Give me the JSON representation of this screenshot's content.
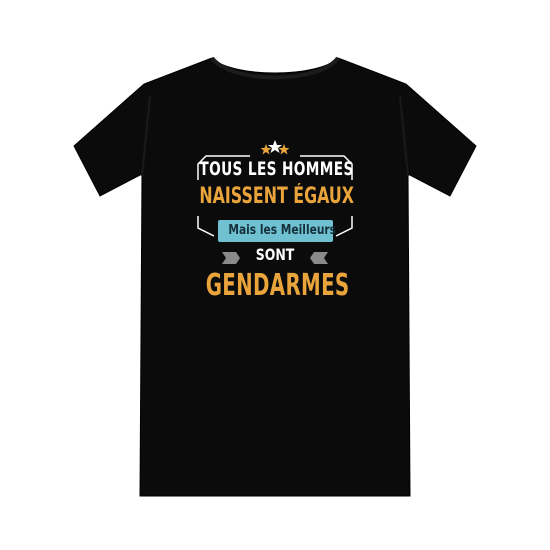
{
  "design": {
    "line1": "TOUS LES HOMMES",
    "line2": "NAISSENT ÉGAUX",
    "line3": "Mais les Meilleurs",
    "line4": "SONT",
    "line5": "GENDARMES"
  },
  "colors": {
    "shirt": "#0b0b0b",
    "white_text": "#ffffff",
    "orange_text": "#e9a43c",
    "banner": "#6fc1d2",
    "banner_text": "#15303a"
  }
}
